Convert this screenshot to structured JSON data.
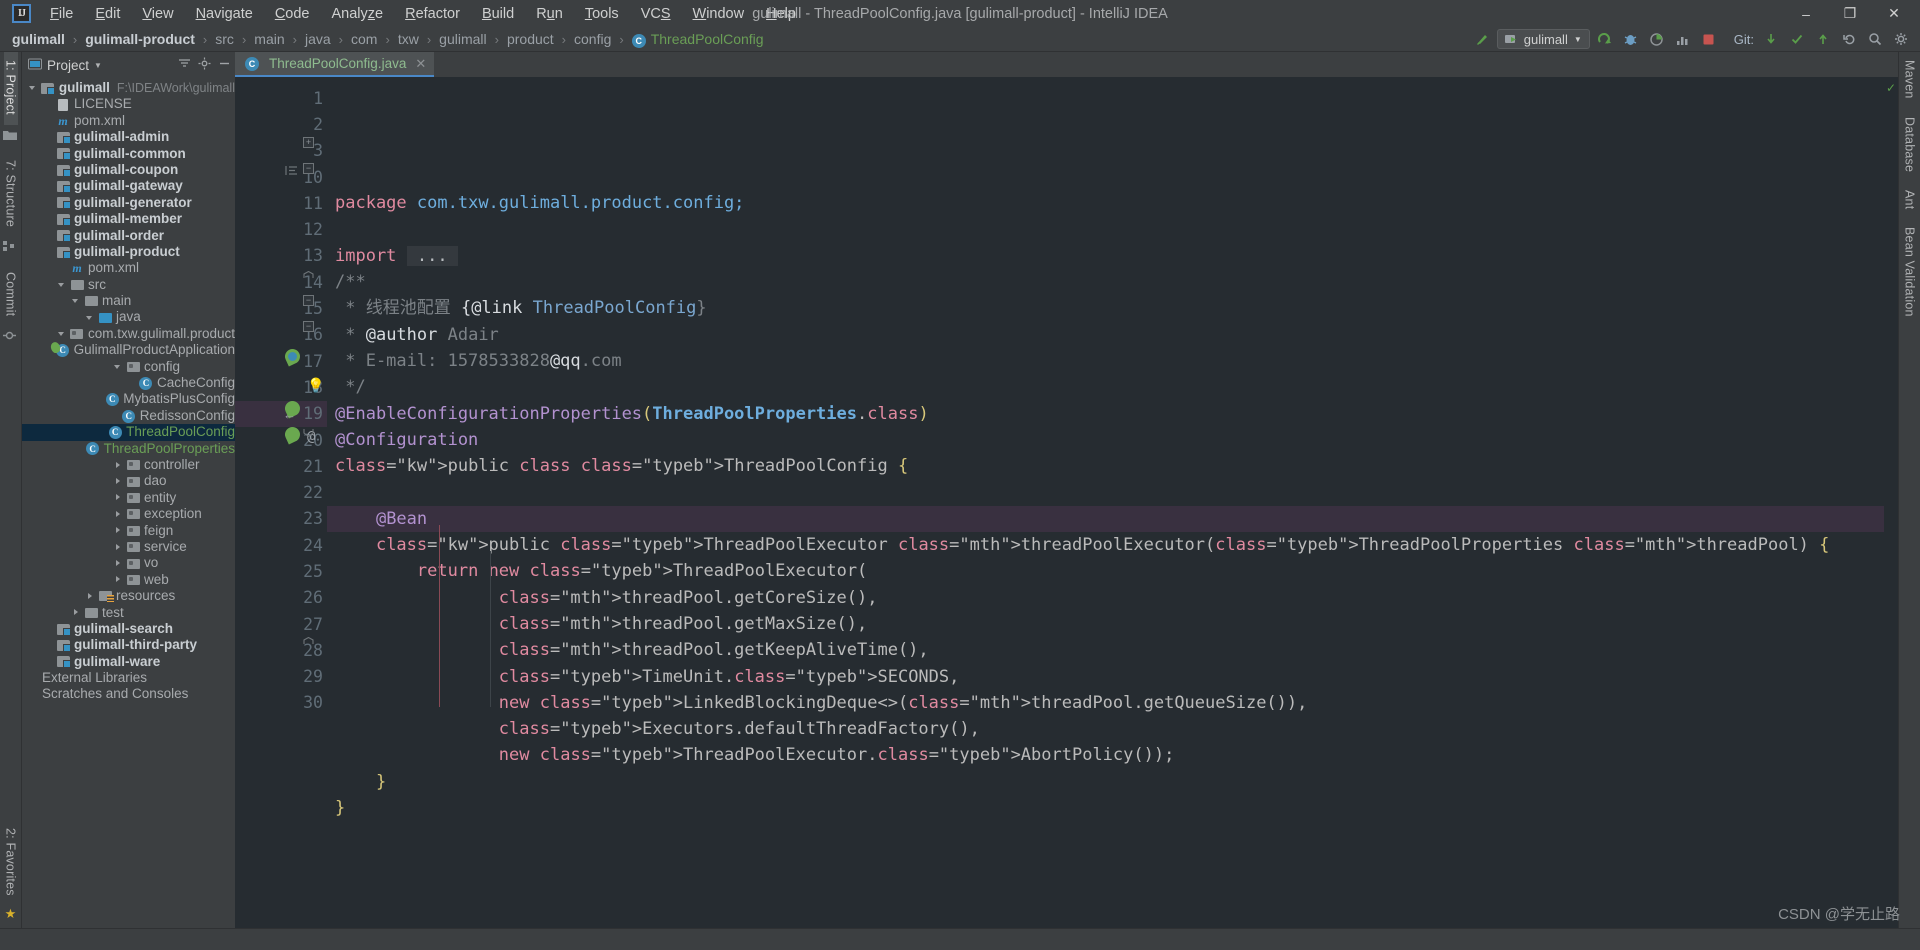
{
  "window": {
    "title": "gulimall - ThreadPoolConfig.java [gulimall-product] - IntelliJ IDEA",
    "logo": "IJ",
    "minimize": "–",
    "maximize": "❐",
    "close": "✕"
  },
  "menu": [
    {
      "label": "File",
      "mnemonic": "F"
    },
    {
      "label": "Edit",
      "mnemonic": "E"
    },
    {
      "label": "View",
      "mnemonic": "V"
    },
    {
      "label": "Navigate",
      "mnemonic": "N"
    },
    {
      "label": "Code",
      "mnemonic": "C"
    },
    {
      "label": "Analyze",
      "mnemonic": "z"
    },
    {
      "label": "Refactor",
      "mnemonic": "R"
    },
    {
      "label": "Build",
      "mnemonic": "B"
    },
    {
      "label": "Run",
      "mnemonic": "u"
    },
    {
      "label": "Tools",
      "mnemonic": "T"
    },
    {
      "label": "VCS",
      "mnemonic": "S"
    },
    {
      "label": "Window",
      "mnemonic": "W"
    },
    {
      "label": "Help",
      "mnemonic": "H"
    }
  ],
  "breadcrumb": {
    "items": [
      "gulimall",
      "gulimall-product",
      "src",
      "main",
      "java",
      "com",
      "txw",
      "gulimall",
      "product",
      "config"
    ],
    "current_class": "ThreadPoolConfig",
    "class_badge": "C",
    "separator": "›"
  },
  "toolbar": {
    "run_config": "gulimall",
    "run_config_caret": "▼",
    "git_label": "Git:",
    "icons": [
      "build-icon",
      "run-icon",
      "debug-icon",
      "run-coverage-icon",
      "profile-icon",
      "stop-icon",
      "git-update-icon",
      "git-commit-icon",
      "git-push-icon",
      "undo-icon",
      "search-everywhere-icon",
      "settings-icon"
    ]
  },
  "left_rail": {
    "top": [
      {
        "label": "1: Project",
        "active": true
      }
    ],
    "middle": [
      {
        "label": "7: Structure",
        "active": false
      },
      {
        "label": "Commit",
        "active": false
      }
    ],
    "bottom": [
      {
        "label": "2: Favorites",
        "active": false
      }
    ]
  },
  "right_rail": {
    "items": [
      "Maven",
      "Database",
      "Ant",
      "Bean Validation"
    ]
  },
  "project_panel": {
    "title": "Project",
    "title_caret": "▼",
    "collapse_icon": "collapse-all-icon",
    "settings_icon": "gear-icon",
    "hide_icon": "hide-icon",
    "tree": [
      {
        "label": "gulimall",
        "path": "F:\\IDEAWork\\gulimall",
        "indent": 0,
        "arrow": "down",
        "icon": "project-root-icon",
        "bold": true
      },
      {
        "label": "LICENSE",
        "indent": 1,
        "arrow": "none",
        "icon": "license-file-icon"
      },
      {
        "label": "pom.xml",
        "indent": 1,
        "arrow": "none",
        "icon": "maven-file-icon"
      },
      {
        "label": "gulimall-admin",
        "indent": 1,
        "arrow": "none",
        "icon": "module-icon",
        "bold": true
      },
      {
        "label": "gulimall-common",
        "indent": 1,
        "arrow": "none",
        "icon": "module-icon",
        "bold": true
      },
      {
        "label": "gulimall-coupon",
        "indent": 1,
        "arrow": "none",
        "icon": "module-icon",
        "bold": true
      },
      {
        "label": "gulimall-gateway",
        "indent": 1,
        "arrow": "none",
        "icon": "module-icon",
        "bold": true
      },
      {
        "label": "gulimall-generator",
        "indent": 1,
        "arrow": "none",
        "icon": "module-icon",
        "bold": true
      },
      {
        "label": "gulimall-member",
        "indent": 1,
        "arrow": "none",
        "icon": "module-icon",
        "bold": true
      },
      {
        "label": "gulimall-order",
        "indent": 1,
        "arrow": "none",
        "icon": "module-icon",
        "bold": true
      },
      {
        "label": "gulimall-product",
        "indent": 1,
        "arrow": "none",
        "icon": "module-icon",
        "bold": true
      },
      {
        "label": "pom.xml",
        "indent": 2,
        "arrow": "none",
        "icon": "maven-file-icon"
      },
      {
        "label": "src",
        "indent": 2,
        "arrow": "down",
        "icon": "folder-icon"
      },
      {
        "label": "main",
        "indent": 3,
        "arrow": "down",
        "icon": "folder-icon"
      },
      {
        "label": "java",
        "indent": 4,
        "arrow": "down",
        "icon": "source-folder-icon"
      },
      {
        "label": "com.txw.gulimall.product",
        "indent": 5,
        "arrow": "down",
        "icon": "package-icon"
      },
      {
        "label": "GulimallProductApplication",
        "indent": 7,
        "arrow": "none",
        "icon": "spring-class-icon"
      },
      {
        "label": "config",
        "indent": 6,
        "arrow": "down",
        "icon": "package-icon"
      },
      {
        "label": "CacheConfig",
        "indent": 7,
        "arrow": "none",
        "icon": "class-icon"
      },
      {
        "label": "MybatisPlusConfig",
        "indent": 7,
        "arrow": "none",
        "icon": "class-icon"
      },
      {
        "label": "RedissonConfig",
        "indent": 7,
        "arrow": "none",
        "icon": "class-icon"
      },
      {
        "label": "ThreadPoolConfig",
        "indent": 7,
        "arrow": "none",
        "icon": "class-icon",
        "selected": true,
        "green": true
      },
      {
        "label": "ThreadPoolProperties",
        "indent": 7,
        "arrow": "none",
        "icon": "class-icon",
        "green": true
      },
      {
        "label": "controller",
        "indent": 6,
        "arrow": "right",
        "icon": "package-icon"
      },
      {
        "label": "dao",
        "indent": 6,
        "arrow": "right",
        "icon": "package-icon"
      },
      {
        "label": "entity",
        "indent": 6,
        "arrow": "right",
        "icon": "package-icon"
      },
      {
        "label": "exception",
        "indent": 6,
        "arrow": "right",
        "icon": "package-icon"
      },
      {
        "label": "feign",
        "indent": 6,
        "arrow": "right",
        "icon": "package-icon"
      },
      {
        "label": "service",
        "indent": 6,
        "arrow": "right",
        "icon": "package-icon"
      },
      {
        "label": "vo",
        "indent": 6,
        "arrow": "right",
        "icon": "package-icon"
      },
      {
        "label": "web",
        "indent": 6,
        "arrow": "right",
        "icon": "package-icon"
      },
      {
        "label": "resources",
        "indent": 4,
        "arrow": "right",
        "icon": "resources-folder-icon"
      },
      {
        "label": "test",
        "indent": 3,
        "arrow": "right",
        "icon": "folder-icon"
      },
      {
        "label": "gulimall-search",
        "indent": 1,
        "arrow": "none",
        "icon": "module-icon",
        "bold": true
      },
      {
        "label": "gulimall-third-party",
        "indent": 1,
        "arrow": "none",
        "icon": "module-icon",
        "bold": true
      },
      {
        "label": "gulimall-ware",
        "indent": 1,
        "arrow": "none",
        "icon": "module-icon",
        "bold": true
      },
      {
        "label": "External Libraries",
        "indent": 0,
        "arrow": "none",
        "icon": "none"
      },
      {
        "label": "Scratches and Consoles",
        "indent": 0,
        "arrow": "none",
        "icon": "none"
      }
    ]
  },
  "editor": {
    "tab": {
      "label": "ThreadPoolConfig.java",
      "badge": "C",
      "close": "✕"
    },
    "current_line": 19,
    "lines": [
      {
        "num": "1",
        "text": "package com.txw.gulimall.product.config;"
      },
      {
        "num": "2",
        "text": ""
      },
      {
        "num": "3",
        "text": "import ..."
      },
      {
        "num": "10",
        "text": "/**"
      },
      {
        "num": "11",
        "text": " * 线程池配置 {@link ThreadPoolConfig}"
      },
      {
        "num": "12",
        "text": " * @author Adair"
      },
      {
        "num": "13",
        "text": " * E-mail: 1578533828@qq.com"
      },
      {
        "num": "14",
        "text": " */"
      },
      {
        "num": "15",
        "text": "@EnableConfigurationProperties(ThreadPoolProperties.class)"
      },
      {
        "num": "16",
        "text": "@Configuration"
      },
      {
        "num": "17",
        "text": "public class ThreadPoolConfig {"
      },
      {
        "num": "18",
        "text": ""
      },
      {
        "num": "19",
        "text": "    @Bean"
      },
      {
        "num": "20",
        "text": "    public ThreadPoolExecutor threadPoolExecutor(ThreadPoolProperties threadPool) {"
      },
      {
        "num": "21",
        "text": "        return new ThreadPoolExecutor("
      },
      {
        "num": "22",
        "text": "                threadPool.getCoreSize(),"
      },
      {
        "num": "23",
        "text": "                threadPool.getMaxSize(),"
      },
      {
        "num": "24",
        "text": "                threadPool.getKeepAliveTime(),"
      },
      {
        "num": "25",
        "text": "                TimeUnit.SECONDS,"
      },
      {
        "num": "26",
        "text": "                new LinkedBlockingDeque<>(threadPool.getQueueSize()),"
      },
      {
        "num": "27",
        "text": "                Executors.defaultThreadFactory(),"
      },
      {
        "num": "28",
        "text": "                new ThreadPoolExecutor.AbortPolicy());"
      },
      {
        "num": "29",
        "text": "    }"
      },
      {
        "num": "30",
        "text": "}"
      }
    ]
  },
  "watermark": "CSDN @学无止路",
  "colors": {
    "accent": "#4a88c7",
    "selection": "#0d293e",
    "current_line": "#393040",
    "editor_bg": "#262c31",
    "panel_bg": "#3c3f41",
    "keyword": "#e08aa0",
    "type": "#6eaede",
    "annotation": "#b392d0",
    "comment": "#7c8287",
    "green_text": "#6a9e56"
  }
}
